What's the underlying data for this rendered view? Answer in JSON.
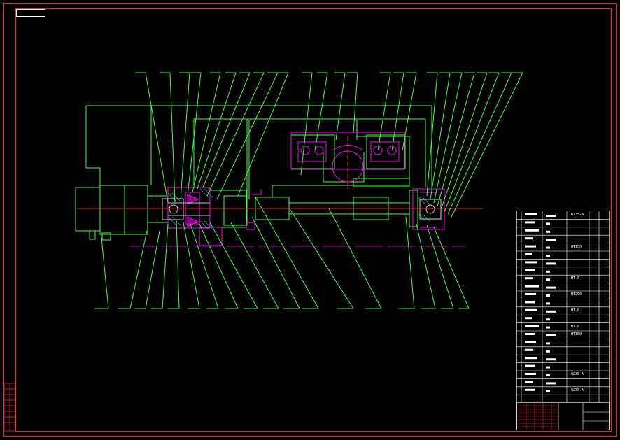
{
  "drawing": {
    "background": "#000000",
    "colors": {
      "frame": "#ff2020",
      "leader": "#40ff40",
      "part": "#ffffff",
      "accent": "#ff00ff",
      "center": "#ff2020"
    },
    "bom_marks": [
      "Q235-A",
      "HT150",
      "HT 6",
      "HT200",
      "HT 6",
      "HT 6",
      "HT150",
      "Q235-A",
      "Q235-A"
    ]
  }
}
